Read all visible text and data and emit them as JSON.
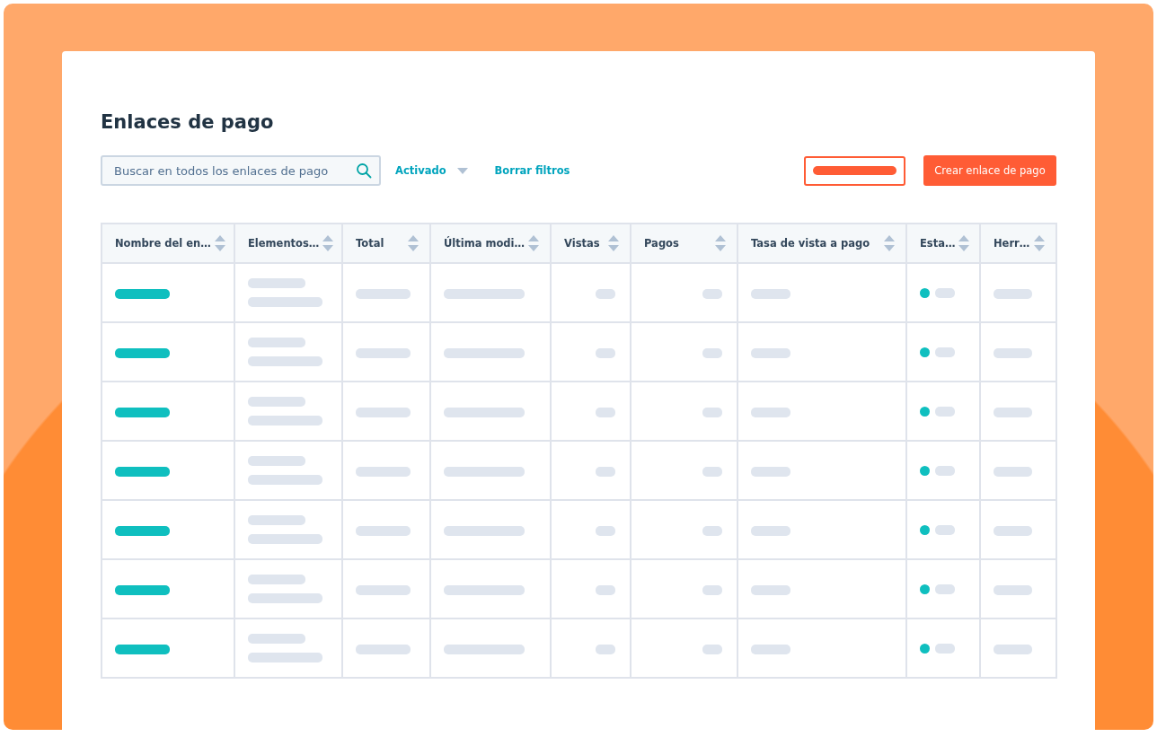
{
  "title": "Enlaces de pago",
  "search": {
    "placeholder": "Buscar en todos los enlaces de pago"
  },
  "filter": {
    "label": "Activado"
  },
  "clear_filters": "Borrar filtros",
  "create_button": "Crear enlace de pago",
  "table": {
    "columns": [
      {
        "label": "Nombre del en…"
      },
      {
        "label": "Elementos…"
      },
      {
        "label": "Total"
      },
      {
        "label": "Última modi…"
      },
      {
        "label": "Vistas"
      },
      {
        "label": "Pagos"
      },
      {
        "label": "Tasa de vista a pago"
      },
      {
        "label": "Esta…"
      },
      {
        "label": "Herr…"
      }
    ],
    "rows": [
      {
        "color": "#0fbfbf"
      },
      {
        "color": "#0fbfbf"
      },
      {
        "color": "#0fbfbf"
      },
      {
        "color": "#0fbfbf"
      },
      {
        "color": "#0fbfbf"
      },
      {
        "color": "#0fbfbf"
      },
      {
        "color": "#0fbfbf"
      }
    ]
  }
}
